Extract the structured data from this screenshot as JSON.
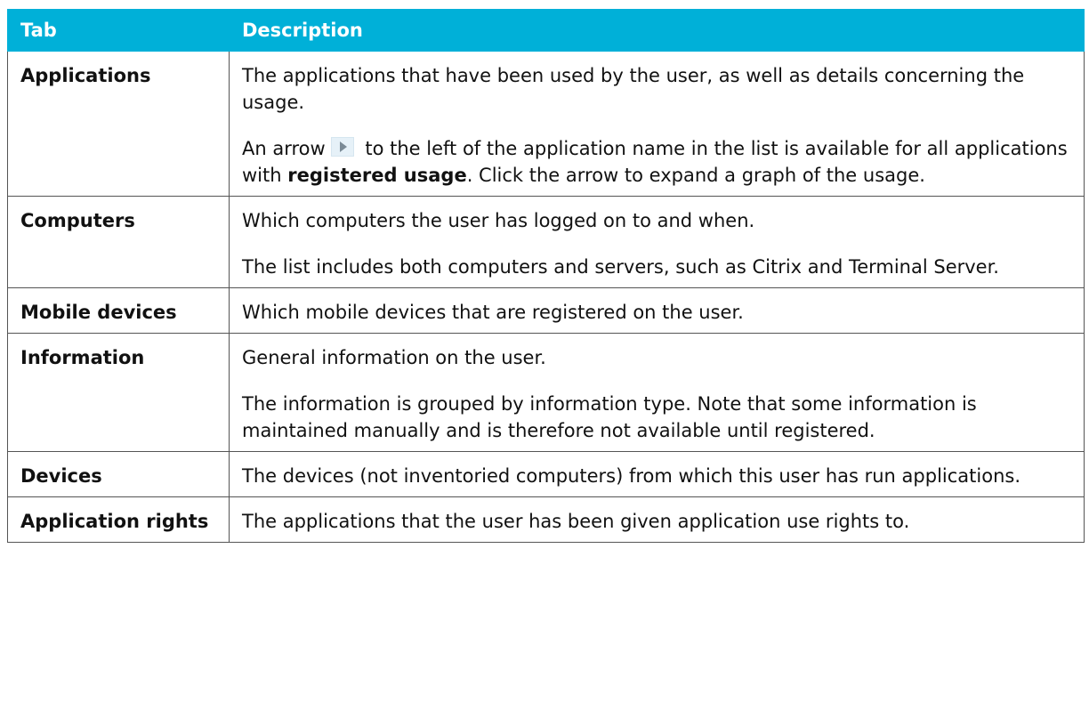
{
  "header": {
    "tab": "Tab",
    "description": "Description"
  },
  "rows": [
    {
      "tab": "Applications",
      "paragraphs": [
        "The applications that have been used by the user, as well as details concerning the usage."
      ],
      "arrow_paragraph": {
        "before_icon": "An arrow",
        "icon": "expand-arrow-icon",
        "after_icon": " to the left of the application name in the list is available for all applications with ",
        "bold": "registered usage",
        "after_bold": ". Click the arrow to expand a graph of the usage."
      }
    },
    {
      "tab": "Computers",
      "paragraphs": [
        "Which computers the user has logged on to and when.",
        "The list includes both computers and servers, such as Citrix and Terminal Server."
      ]
    },
    {
      "tab": "Mobile devices",
      "paragraphs": [
        "Which mobile devices that are registered on the user."
      ]
    },
    {
      "tab": "Information",
      "paragraphs": [
        "General information on the user.",
        "The information is grouped by information type. Note that some information is maintained manually and is therefore not available until registered."
      ]
    },
    {
      "tab": "Devices",
      "paragraphs": [
        "The devices (not inventoried computers) from which this user has run applications."
      ]
    },
    {
      "tab": "Application rights",
      "paragraphs": [
        "The applications that the user has been given application use rights to."
      ]
    }
  ],
  "colors": {
    "header_bg": "#00b0d8",
    "header_text": "#ffffff",
    "border": "#555555"
  }
}
